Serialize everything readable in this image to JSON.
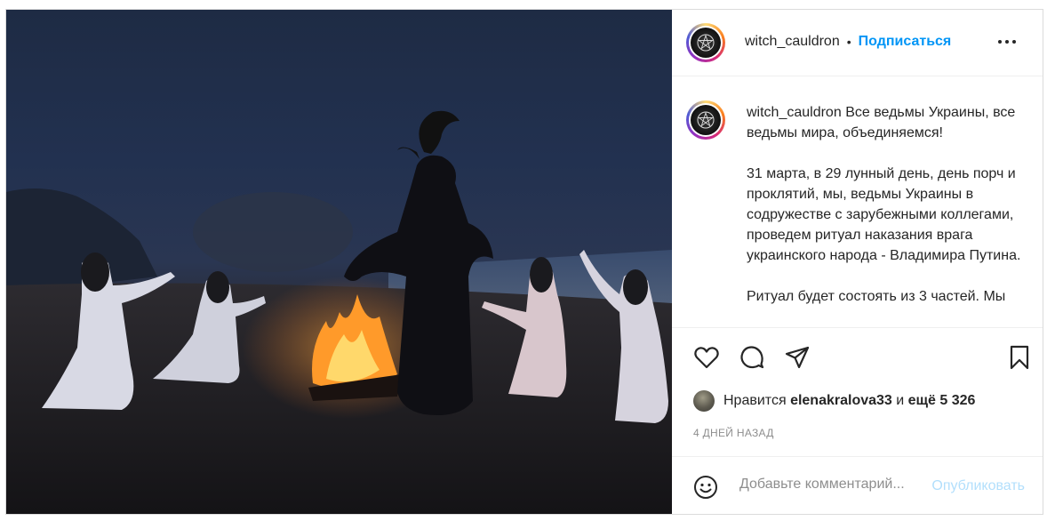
{
  "post": {
    "username": "witch_cauldron",
    "separator": "•",
    "follow_label": "Подписаться",
    "more_icon": "more-options-icon",
    "caption": [
      "Все ведьмы Украины, все ведьмы мира, объединяемся!",
      "31 марта, в 29 лунный день, день порч и проклятий, мы, ведьмы Украины в содружестве с зарубежными коллегами, проведем ритуал наказания врага украинского народа - Владимира Путина.",
      "Ритуал будет состоять из 3 частей. Мы"
    ],
    "likes": {
      "prefix": "Нравится",
      "user": "elenakralova33",
      "middle": "и",
      "others": "ещё 5 326"
    },
    "timestamp": "4 ДНЕЙ НАЗАД",
    "comment_placeholder": "Добавьте комментарий...",
    "publish_label": "Опубликовать",
    "icons": [
      "heart-icon",
      "comment-icon",
      "share-icon",
      "bookmark-icon",
      "emoji-icon"
    ],
    "colors": {
      "accent": "#0095f6",
      "publish_disabled": "#b2dffc",
      "muted": "#8e8e8e"
    }
  }
}
